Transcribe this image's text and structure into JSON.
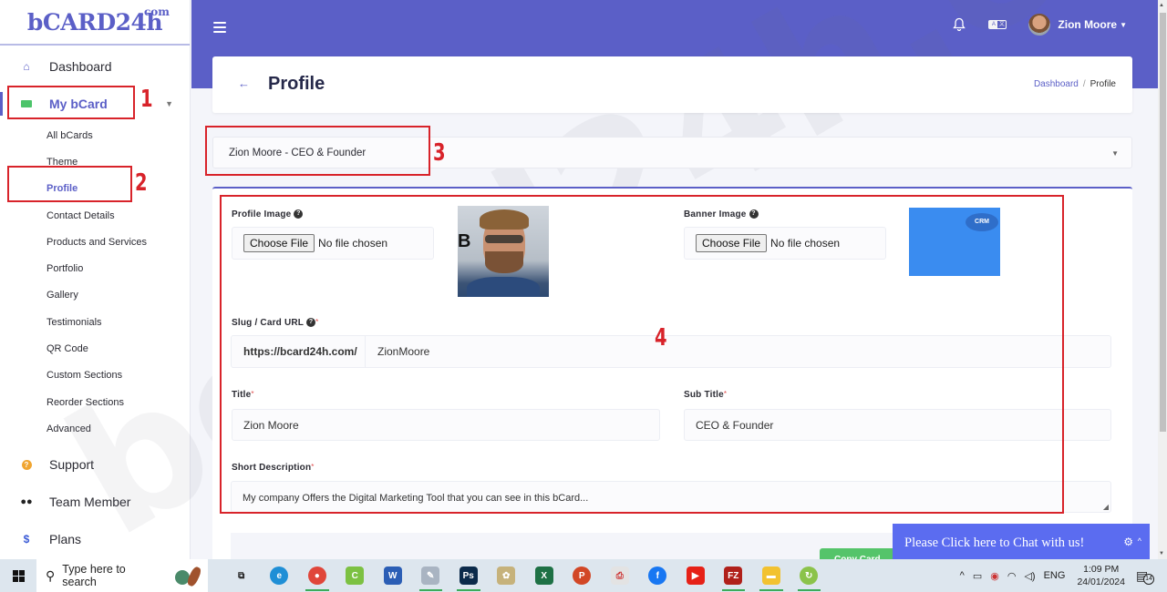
{
  "brand": {
    "logo_text": "bCARD24h",
    "logo_suffix": ".com",
    "accent": "#5b5fc7"
  },
  "sidebar": {
    "items": [
      {
        "label": "Dashboard",
        "icon": "home-icon"
      },
      {
        "label": "My bCard",
        "icon": "id-card-icon",
        "active": true,
        "expanded": true
      },
      {
        "label": "Support",
        "icon": "question-circle-icon"
      },
      {
        "label": "Team Member",
        "icon": "users-icon"
      },
      {
        "label": "Plans",
        "icon": "dollar-icon"
      }
    ],
    "sub_items": [
      {
        "label": "All bCards"
      },
      {
        "label": "Theme"
      },
      {
        "label": "Profile",
        "active": true
      },
      {
        "label": "Contact Details"
      },
      {
        "label": "Products and Services"
      },
      {
        "label": "Portfolio"
      },
      {
        "label": "Gallery"
      },
      {
        "label": "Testimonials"
      },
      {
        "label": "QR Code"
      },
      {
        "label": "Custom Sections"
      },
      {
        "label": "Reorder Sections"
      },
      {
        "label": "Advanced"
      }
    ]
  },
  "header": {
    "user_name": "Zion Moore",
    "icons": [
      "menu-icon",
      "bell-icon",
      "language-icon"
    ],
    "lang_left": "A",
    "lang_right": "文"
  },
  "page": {
    "title": "Profile",
    "breadcrumb": [
      {
        "label": "Dashboard"
      },
      {
        "label": "Profile"
      }
    ],
    "breadcrumb_sep": "/"
  },
  "card_select": {
    "value": "Zion Moore - CEO & Founder"
  },
  "form": {
    "profile_image": {
      "label": "Profile Image",
      "button": "Choose File",
      "status": "No file chosen"
    },
    "banner_image": {
      "label": "Banner Image",
      "button": "Choose File",
      "status": "No file chosen",
      "banner_text": "CRM"
    },
    "slug": {
      "label": "Slug / Card URL",
      "prefix": "https://bcard24h.com/",
      "value": "ZionMoore",
      "required_mark": "*"
    },
    "title": {
      "label": "Title",
      "value": "Zion Moore",
      "required_mark": "*"
    },
    "subtitle": {
      "label": "Sub Title",
      "value": "CEO & Founder",
      "required_mark": "*"
    },
    "short_description": {
      "label": "Short Description",
      "value": "My company Offers the Digital Marketing Tool that you can see in this bCard...",
      "required_mark": "*"
    },
    "copy_button": "Copy Card"
  },
  "annotations": {
    "n1": "1",
    "n2": "2",
    "n3": "3",
    "n4": "4",
    "color": "#d8232a"
  },
  "watermark": "bcard24h.com",
  "chat": {
    "text": "Please Click here to Chat with us!"
  },
  "taskbar": {
    "search_placeholder": "Type here to search",
    "apps": [
      {
        "name": "task-view",
        "glyph": "⧉",
        "color": "#dde6ee",
        "text_color": "#222"
      },
      {
        "name": "edge",
        "glyph": "e",
        "color": "#1f8fd6"
      },
      {
        "name": "chrome",
        "glyph": "●",
        "color": "#e0463a",
        "open": true
      },
      {
        "name": "coccoc",
        "glyph": "C",
        "color": "#7cc142"
      },
      {
        "name": "word",
        "glyph": "W",
        "color": "#2b5eb5"
      },
      {
        "name": "notepad",
        "glyph": "✎",
        "color": "#a9b4c2",
        "open": true
      },
      {
        "name": "photoshop",
        "glyph": "Ps",
        "color": "#0b2a4a",
        "open": true
      },
      {
        "name": "paint",
        "glyph": "✿",
        "color": "#c6b27b"
      },
      {
        "name": "excel",
        "glyph": "X",
        "color": "#1e7145"
      },
      {
        "name": "powerpoint",
        "glyph": "P",
        "color": "#d24726"
      },
      {
        "name": "pdf",
        "glyph": "⎙",
        "color": "#e3e3e3",
        "text_color": "#c33"
      },
      {
        "name": "facebook",
        "glyph": "f",
        "color": "#1877f2"
      },
      {
        "name": "youtube",
        "glyph": "▶",
        "color": "#e62117"
      },
      {
        "name": "filezilla",
        "glyph": "FZ",
        "color": "#b0201a",
        "open": true
      },
      {
        "name": "file-explorer",
        "glyph": "▬",
        "color": "#f2c230",
        "open": true
      },
      {
        "name": "sync-app",
        "glyph": "↻",
        "color": "#8bc34a",
        "open": true
      }
    ],
    "tray": {
      "lang": "ENG",
      "time": "1:09 PM",
      "date": "24/01/2024",
      "notifications": "14"
    }
  }
}
